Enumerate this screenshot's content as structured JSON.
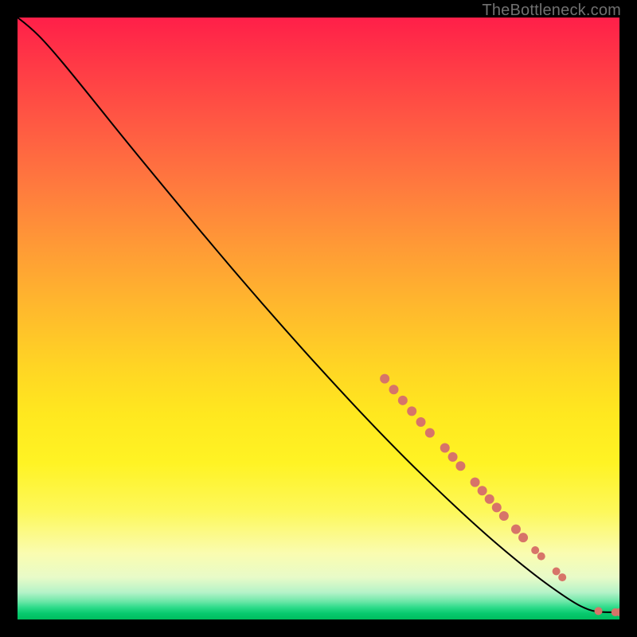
{
  "attribution": "TheBottleneck.com",
  "chart_data": {
    "type": "line",
    "title": "",
    "xlabel": "",
    "ylabel": "",
    "xlim": [
      0,
      100
    ],
    "ylim": [
      0,
      100
    ],
    "grid": false,
    "legend": false,
    "curve": [
      {
        "x": 0,
        "y": 100
      },
      {
        "x": 2,
        "y": 98.5
      },
      {
        "x": 5,
        "y": 95.5
      },
      {
        "x": 10,
        "y": 89.5
      },
      {
        "x": 20,
        "y": 77.0
      },
      {
        "x": 40,
        "y": 53.0
      },
      {
        "x": 60,
        "y": 31.0
      },
      {
        "x": 75,
        "y": 16.5
      },
      {
        "x": 85,
        "y": 8.0
      },
      {
        "x": 92,
        "y": 3.0
      },
      {
        "x": 95,
        "y": 1.5
      },
      {
        "x": 97,
        "y": 1.2
      },
      {
        "x": 100,
        "y": 1.2
      }
    ],
    "markers": [
      {
        "x": 61.0,
        "y": 40.0,
        "r": 6
      },
      {
        "x": 62.5,
        "y": 38.2,
        "r": 6
      },
      {
        "x": 64.0,
        "y": 36.4,
        "r": 6
      },
      {
        "x": 65.5,
        "y": 34.6,
        "r": 6
      },
      {
        "x": 67.0,
        "y": 32.8,
        "r": 6
      },
      {
        "x": 68.5,
        "y": 31.0,
        "r": 6
      },
      {
        "x": 71.0,
        "y": 28.5,
        "r": 6
      },
      {
        "x": 72.3,
        "y": 27.0,
        "r": 6
      },
      {
        "x": 73.6,
        "y": 25.5,
        "r": 6
      },
      {
        "x": 76.0,
        "y": 22.8,
        "r": 6
      },
      {
        "x": 77.2,
        "y": 21.4,
        "r": 6
      },
      {
        "x": 78.4,
        "y": 20.0,
        "r": 6
      },
      {
        "x": 79.6,
        "y": 18.6,
        "r": 6
      },
      {
        "x": 80.8,
        "y": 17.2,
        "r": 6
      },
      {
        "x": 82.8,
        "y": 15.0,
        "r": 6
      },
      {
        "x": 84.0,
        "y": 13.6,
        "r": 6
      },
      {
        "x": 86.0,
        "y": 11.5,
        "r": 5
      },
      {
        "x": 87.0,
        "y": 10.5,
        "r": 5
      },
      {
        "x": 89.5,
        "y": 8.0,
        "r": 5
      },
      {
        "x": 90.5,
        "y": 7.0,
        "r": 5
      },
      {
        "x": 96.5,
        "y": 1.4,
        "r": 5
      },
      {
        "x": 99.3,
        "y": 1.2,
        "r": 5
      },
      {
        "x": 100.0,
        "y": 1.2,
        "r": 5
      }
    ],
    "marker_color": "#d77469",
    "line_color": "#000000"
  }
}
